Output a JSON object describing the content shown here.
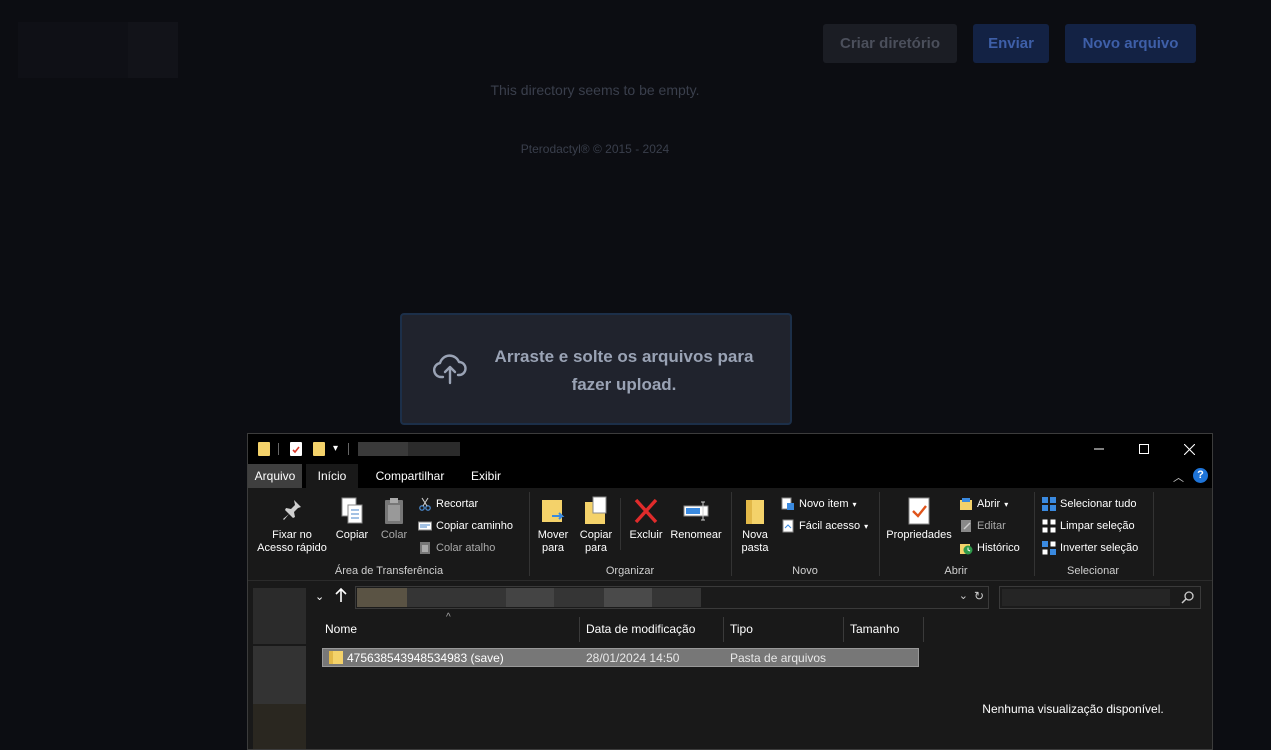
{
  "web": {
    "buttons": {
      "create_dir": "Criar diretório",
      "upload": "Enviar",
      "new_file": "Novo arquivo"
    },
    "empty_message": "This directory seems to be empty.",
    "footer": "Pterodactyl® © 2015 - 2024",
    "dropzone_text": "Arraste e solte os arquivos para fazer upload."
  },
  "explorer": {
    "tabs": [
      "Arquivo",
      "Início",
      "Compartilhar",
      "Exibir"
    ],
    "clipboard": {
      "pin": "Fixar no Acesso rápido",
      "copy": "Copiar",
      "paste": "Colar",
      "cut": "Recortar",
      "copy_path": "Copiar caminho",
      "paste_shortcut": "Colar atalho",
      "group": "Área de Transferência"
    },
    "organize": {
      "move_to": "Mover para",
      "copy_to": "Copiar para",
      "delete": "Excluir",
      "rename": "Renomear",
      "group": "Organizar"
    },
    "new": {
      "new_folder": "Nova pasta",
      "new_item": "Novo item",
      "easy_access": "Fácil acesso",
      "group": "Novo"
    },
    "open": {
      "properties": "Propriedades",
      "open": "Abrir",
      "edit": "Editar",
      "history": "Histórico",
      "group": "Abrir"
    },
    "select": {
      "select_all": "Selecionar tudo",
      "select_none": "Limpar seleção",
      "invert": "Inverter seleção",
      "group": "Selecionar"
    },
    "columns": [
      "Nome",
      "Data de modificação",
      "Tipo",
      "Tamanho"
    ],
    "files": [
      {
        "name": "475638543948534983 (save)",
        "modified": "28/01/2024 14:50",
        "type": "Pasta de arquivos",
        "size": ""
      }
    ],
    "preview_text": "Nenhuma visualização disponível."
  }
}
